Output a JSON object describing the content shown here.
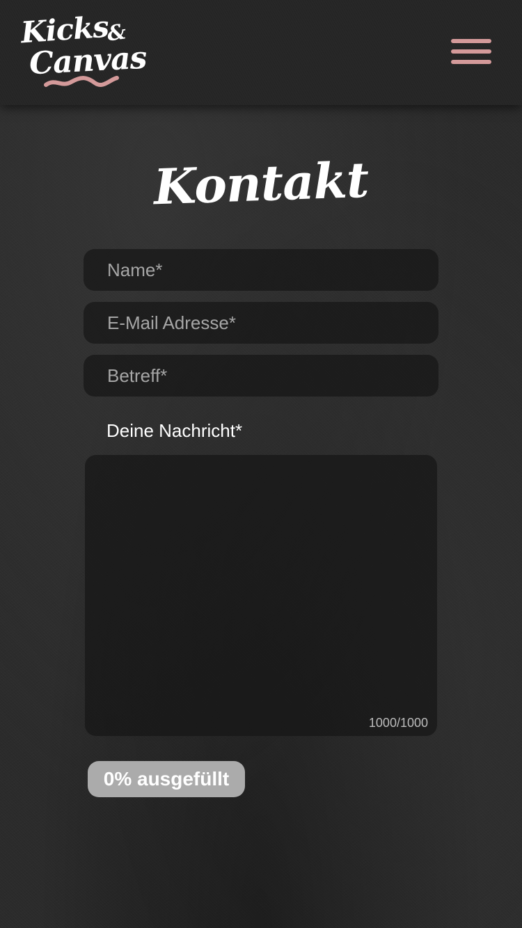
{
  "brand": {
    "logo_line1": "Kicks",
    "logo_amp": "&",
    "logo_line2": "Canvas",
    "accent_color": "#d49a9a"
  },
  "header": {
    "menu_icon": "hamburger-menu-icon"
  },
  "page": {
    "title": "Kontakt"
  },
  "form": {
    "name_placeholder": "Name*",
    "email_placeholder": "E-Mail Adresse*",
    "subject_placeholder": "Betreff*",
    "message_label": "Deine Nachricht*",
    "message_value": "",
    "char_counter": "1000/1000",
    "progress_text": "0% ausgefüllt",
    "progress_fraction": 0
  }
}
